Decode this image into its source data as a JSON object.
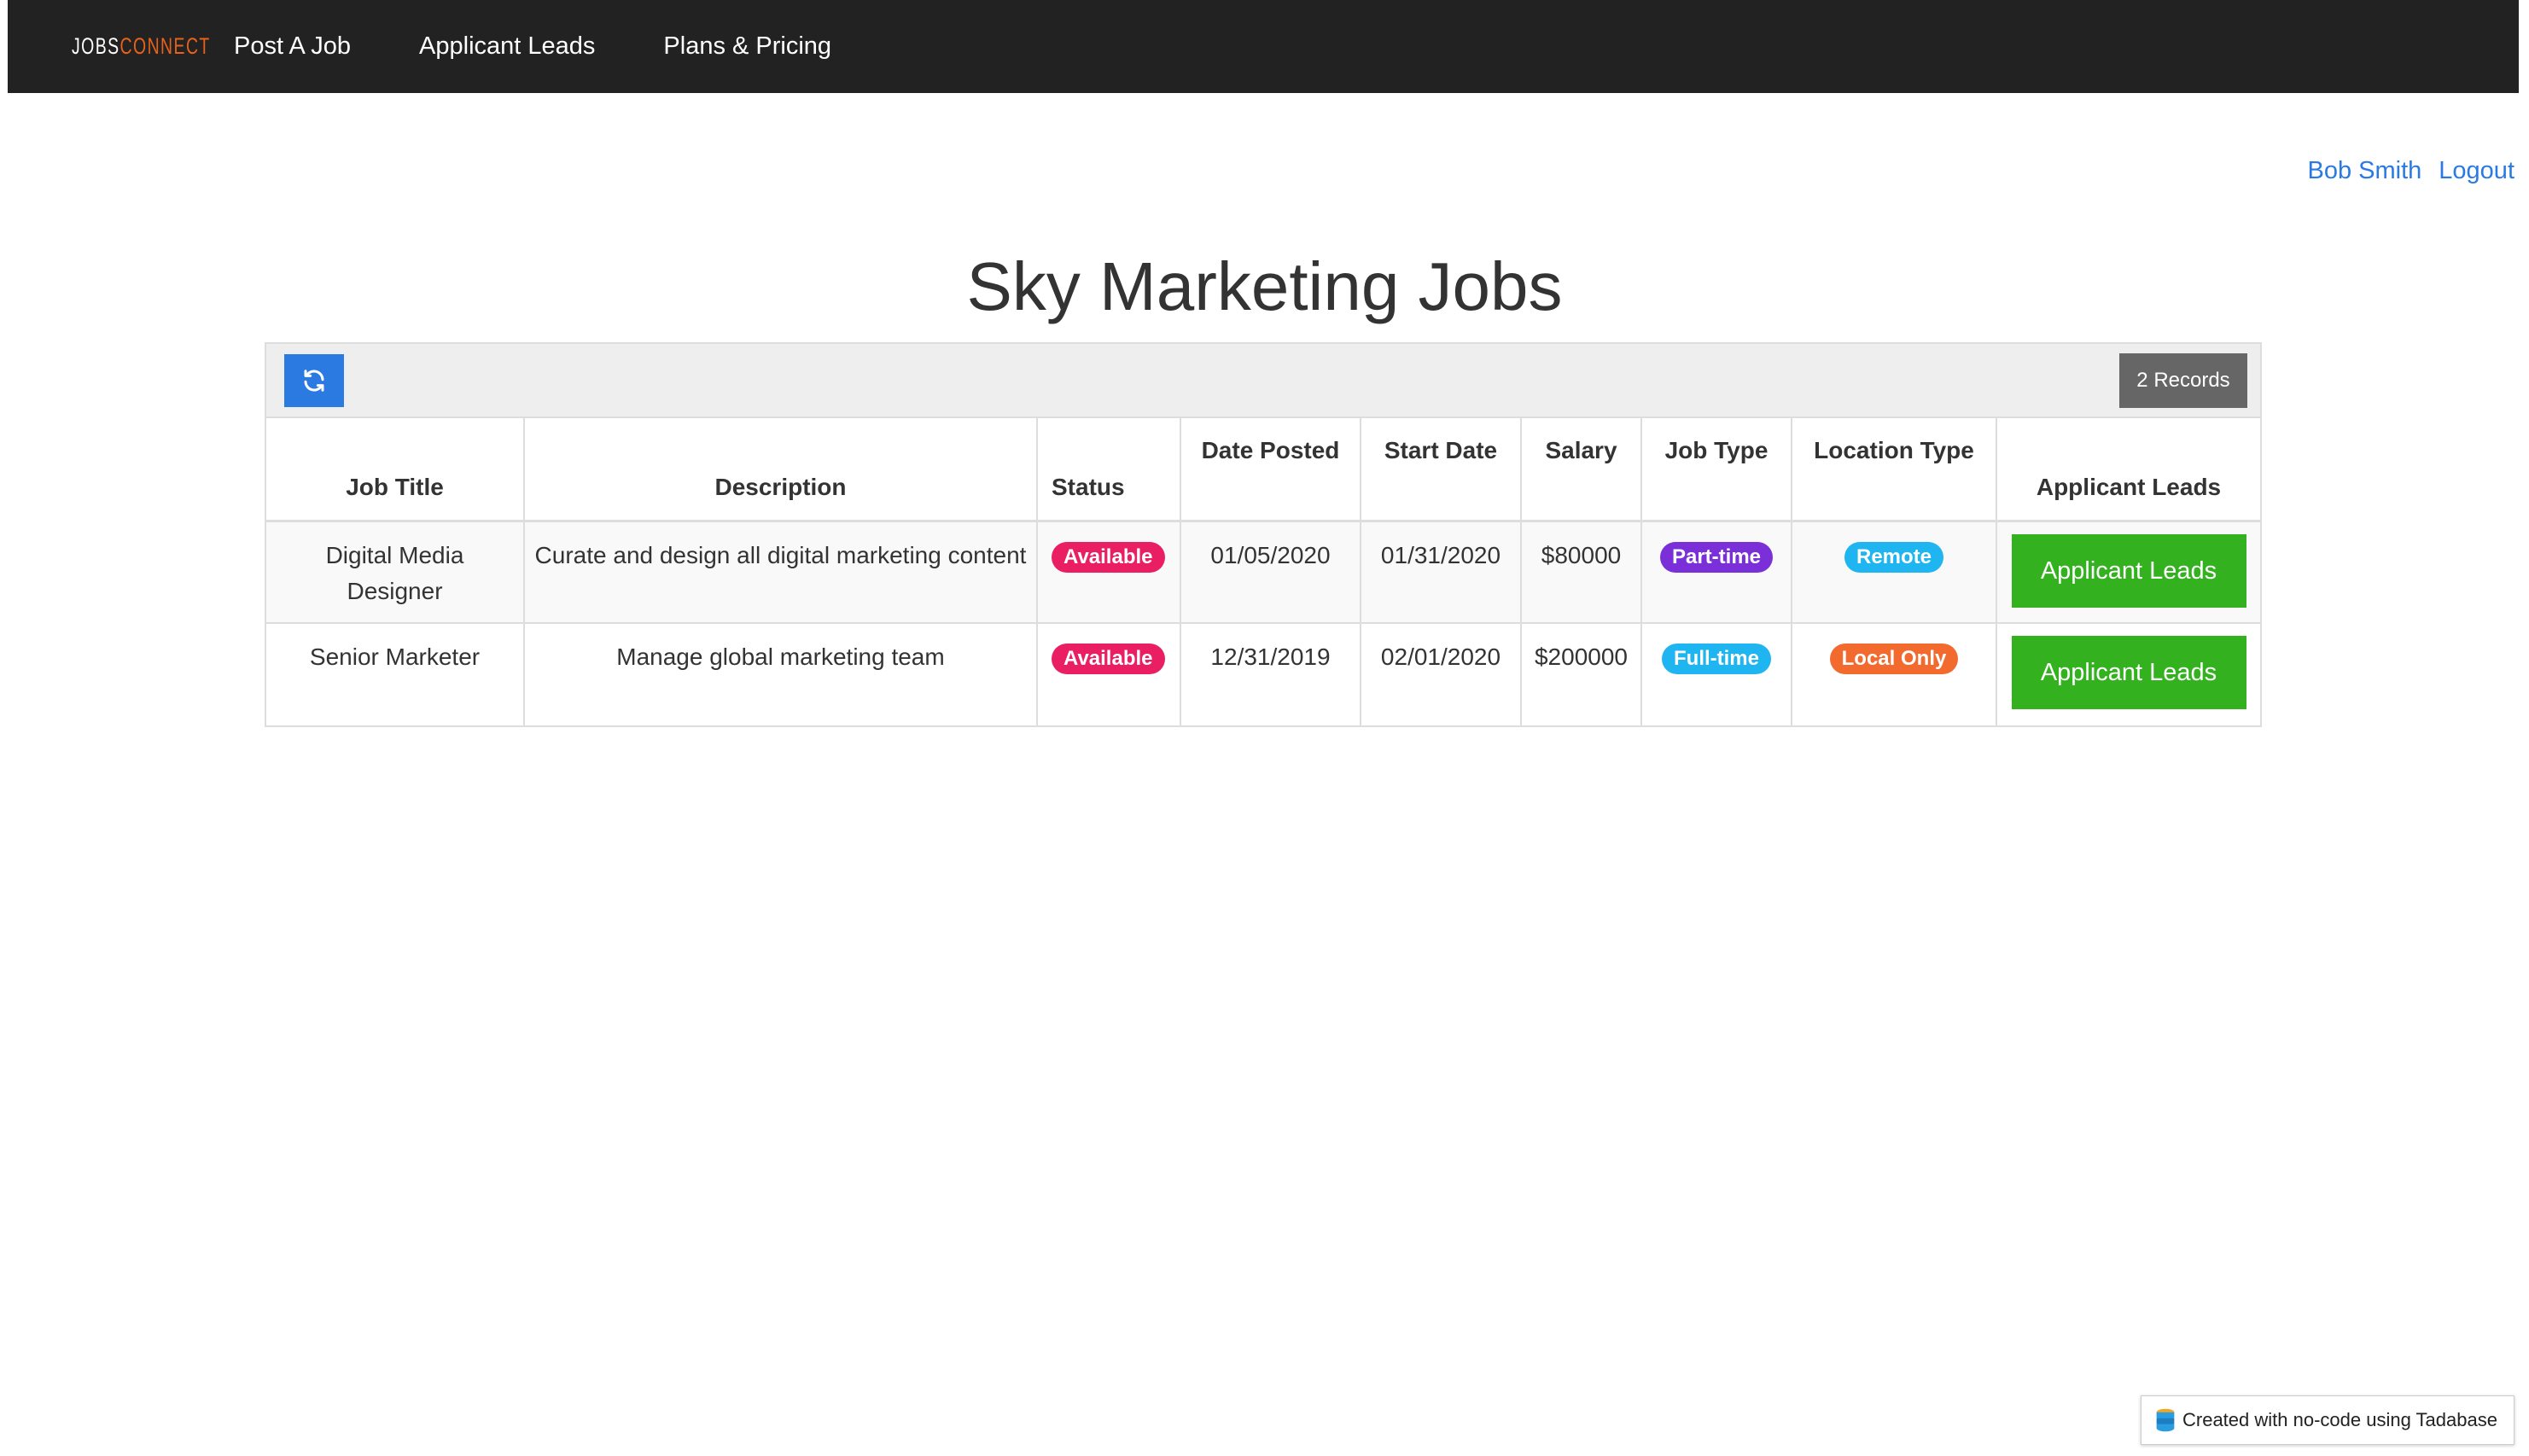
{
  "navbar": {
    "logo_part1": "JOBS",
    "logo_part2": "CONNECT",
    "links": [
      "Post A Job",
      "Applicant Leads",
      "Plans & Pricing"
    ]
  },
  "user": {
    "name": "Bob Smith",
    "logout": "Logout"
  },
  "page": {
    "title": "Sky Marketing Jobs"
  },
  "table": {
    "records_label": "2 Records",
    "headers": [
      "Job Title",
      "Description",
      "Status",
      "Date Posted",
      "Start Date",
      "Salary",
      "Job Type",
      "Location Type",
      "Applicant Leads"
    ],
    "rows": [
      {
        "job_title": "Digital Media Designer",
        "description": "Curate and design all digital marketing content",
        "status": "Available",
        "date_posted": "01/05/2020",
        "start_date": "01/31/2020",
        "salary": "$80000",
        "job_type": "Part-time",
        "location_type": "Remote",
        "action": "Applicant Leads"
      },
      {
        "job_title": "Senior Marketer",
        "description": "Manage global marketing team",
        "status": "Available",
        "date_posted": "12/31/2019",
        "start_date": "02/01/2020",
        "salary": "$200000",
        "job_type": "Full-time",
        "location_type": "Local Only",
        "action": "Applicant Leads"
      }
    ]
  },
  "footer": {
    "badge_text": "Created with no-code using Tadabase"
  },
  "colors": {
    "navbar_bg": "#222222",
    "logo_accent": "#e8621c",
    "link_blue": "#2a7ae2",
    "status_available": "#e91e63",
    "job_type_part_time": "#7b2fd9",
    "job_type_full_time": "#1fb5f0",
    "location_remote": "#1fb5f0",
    "location_local_only": "#f26a2e",
    "action_green": "#33b11f",
    "records_badge": "#666666"
  },
  "icons": {
    "refresh": "refresh-icon",
    "tadabase": "tadabase-logo-icon"
  }
}
